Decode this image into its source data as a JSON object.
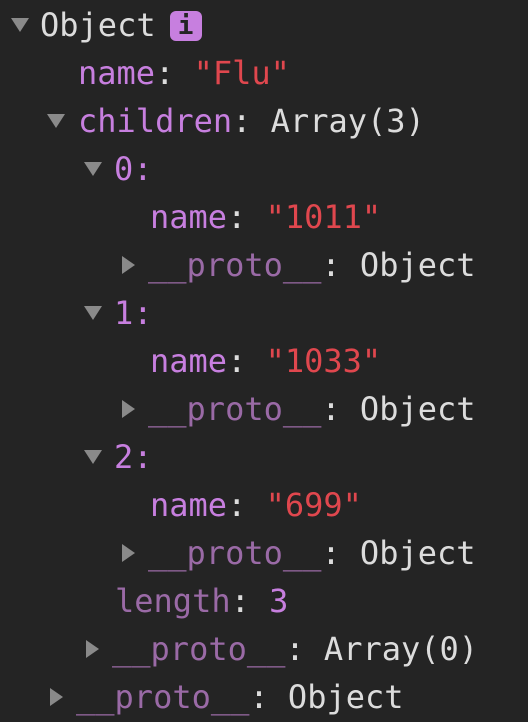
{
  "root": {
    "label": "Object",
    "info_badge": "i"
  },
  "name": {
    "key": "name",
    "value": "\"Flu\""
  },
  "children": {
    "key": "children",
    "value": "Array(3)",
    "items": [
      {
        "index": "0",
        "name_key": "name",
        "name_value": "\"1011\"",
        "proto_key": "__proto__",
        "proto_value": "Object"
      },
      {
        "index": "1",
        "name_key": "name",
        "name_value": "\"1033\"",
        "proto_key": "__proto__",
        "proto_value": "Object"
      },
      {
        "index": "2",
        "name_key": "name",
        "name_value": "\"699\"",
        "proto_key": "__proto__",
        "proto_value": "Object"
      }
    ],
    "length_key": "length",
    "length_value": "3",
    "proto_key": "__proto__",
    "proto_value": "Array(0)"
  },
  "root_proto": {
    "key": "__proto__",
    "value": "Object"
  },
  "colors": {
    "background": "#242424",
    "key": "#c77fdf",
    "dim_key": "#9a6aa6",
    "string": "#e0474e"
  }
}
